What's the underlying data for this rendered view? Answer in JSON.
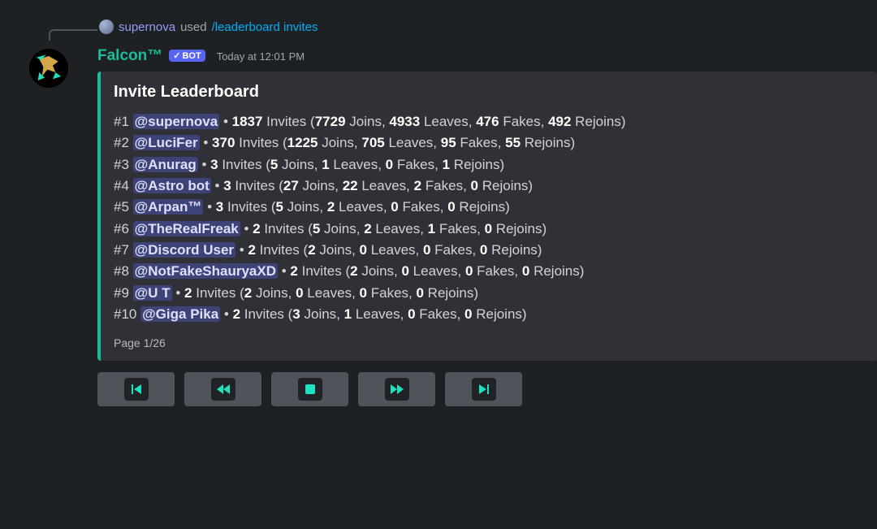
{
  "reply": {
    "user": "supernova",
    "verb": "used",
    "command": "/leaderboard invites"
  },
  "header": {
    "bot_name": "Falcon™",
    "bot_tag": "BOT",
    "timestamp": "Today at 12:01 PM"
  },
  "embed": {
    "title": "Invite Leaderboard",
    "rows": [
      {
        "rank": "#1",
        "mention": "@supernova",
        "invites": "1837",
        "joins": "7729",
        "leaves": "4933",
        "fakes": "476",
        "rejoins": "492"
      },
      {
        "rank": "#2",
        "mention": "@LuciFer",
        "invites": "370",
        "joins": "1225",
        "leaves": "705",
        "fakes": "95",
        "rejoins": "55"
      },
      {
        "rank": "#3",
        "mention": "@Anurag",
        "invites": "3",
        "joins": "5",
        "leaves": "1",
        "fakes": "0",
        "rejoins": "1"
      },
      {
        "rank": "#4",
        "mention": "@Astro bot",
        "invites": "3",
        "joins": "27",
        "leaves": "22",
        "fakes": "2",
        "rejoins": "0"
      },
      {
        "rank": "#5",
        "mention": "@Arpan™",
        "invites": "3",
        "joins": "5",
        "leaves": "2",
        "fakes": "0",
        "rejoins": "0"
      },
      {
        "rank": "#6",
        "mention": "@TheRealFreak",
        "invites": "2",
        "joins": "5",
        "leaves": "2",
        "fakes": "1",
        "rejoins": "0"
      },
      {
        "rank": "#7",
        "mention": "@Discord User",
        "invites": "2",
        "joins": "2",
        "leaves": "0",
        "fakes": "0",
        "rejoins": "0"
      },
      {
        "rank": "#8",
        "mention": "@NotFakeShauryaXD",
        "invites": "2",
        "joins": "2",
        "leaves": "0",
        "fakes": "0",
        "rejoins": "0"
      },
      {
        "rank": "#9",
        "mention": "@U T",
        "invites": "2",
        "joins": "2",
        "leaves": "0",
        "fakes": "0",
        "rejoins": "0"
      },
      {
        "rank": "#10",
        "mention": "@Giga Pika",
        "invites": "2",
        "joins": "3",
        "leaves": "1",
        "fakes": "0",
        "rejoins": "0"
      }
    ],
    "footer": "Page 1/26"
  },
  "labels": {
    "invites": "Invites",
    "joins": "Joins",
    "leaves": "Leaves",
    "fakes": "Fakes",
    "rejoins": "Rejoins"
  },
  "nav": {
    "first": "first",
    "prev": "previous",
    "stop": "stop",
    "next": "next",
    "last": "last"
  }
}
